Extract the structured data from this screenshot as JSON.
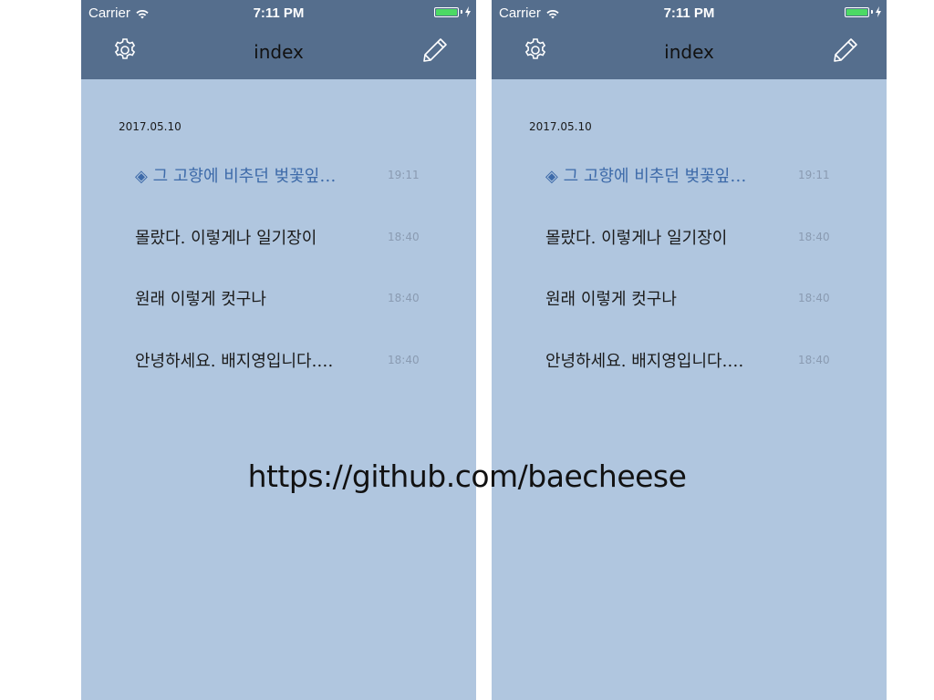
{
  "status": {
    "carrier": "Carrier",
    "time": "7:11 PM"
  },
  "nav": {
    "title": "index",
    "left_icon": "gear-icon",
    "right_icon": "pencil-icon"
  },
  "date_header": "2017.05.10",
  "entries": [
    {
      "title": "◈ 그 고향에 비추던 벚꽃잎…",
      "time": "19:11",
      "active": true
    },
    {
      "title": "몰랐다. 이렇게나 일기장이",
      "time": "18:40",
      "active": false
    },
    {
      "title": "원래 이렇게 컷구나",
      "time": "18:40",
      "active": false
    },
    {
      "title": "안녕하세요. 배지영입니다.…",
      "time": "18:40",
      "active": false
    }
  ],
  "watermark": "https://github.com/baecheese",
  "colors": {
    "navbar": "#556e8d",
    "background": "#b0c6df",
    "accent": "#3d6aa9",
    "battery": "#4cd964"
  }
}
